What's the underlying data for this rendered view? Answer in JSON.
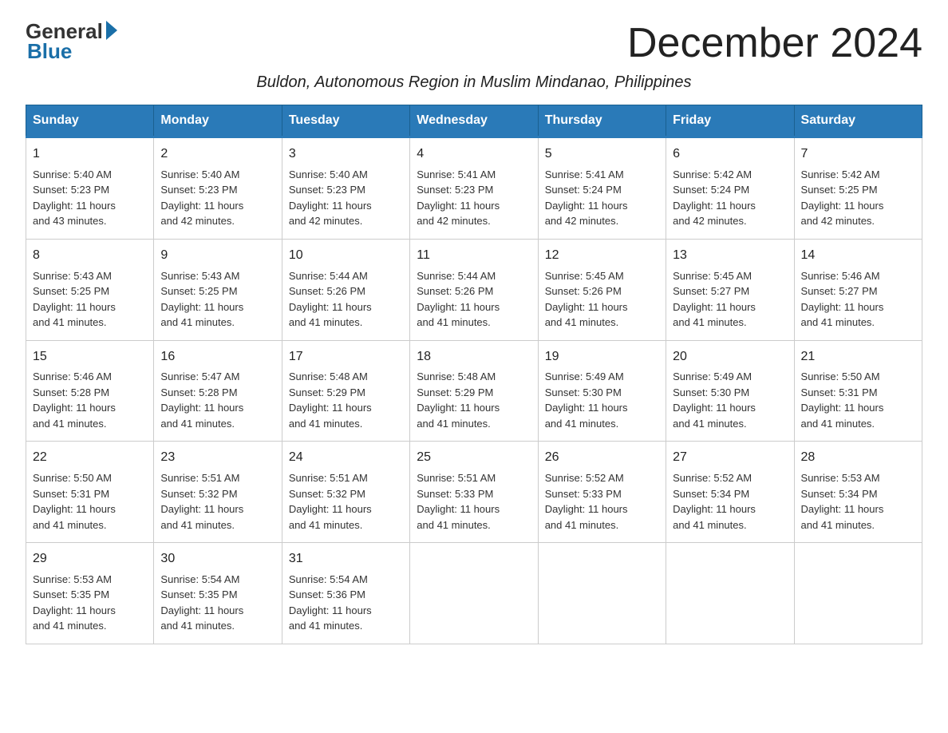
{
  "logo": {
    "general": "General",
    "blue": "Blue"
  },
  "title": "December 2024",
  "subtitle": "Buldon, Autonomous Region in Muslim Mindanao, Philippines",
  "days_header": [
    "Sunday",
    "Monday",
    "Tuesday",
    "Wednesday",
    "Thursday",
    "Friday",
    "Saturday"
  ],
  "weeks": [
    [
      {
        "num": "1",
        "sunrise": "5:40 AM",
        "sunset": "5:23 PM",
        "daylight": "11 hours and 43 minutes."
      },
      {
        "num": "2",
        "sunrise": "5:40 AM",
        "sunset": "5:23 PM",
        "daylight": "11 hours and 42 minutes."
      },
      {
        "num": "3",
        "sunrise": "5:40 AM",
        "sunset": "5:23 PM",
        "daylight": "11 hours and 42 minutes."
      },
      {
        "num": "4",
        "sunrise": "5:41 AM",
        "sunset": "5:23 PM",
        "daylight": "11 hours and 42 minutes."
      },
      {
        "num": "5",
        "sunrise": "5:41 AM",
        "sunset": "5:24 PM",
        "daylight": "11 hours and 42 minutes."
      },
      {
        "num": "6",
        "sunrise": "5:42 AM",
        "sunset": "5:24 PM",
        "daylight": "11 hours and 42 minutes."
      },
      {
        "num": "7",
        "sunrise": "5:42 AM",
        "sunset": "5:25 PM",
        "daylight": "11 hours and 42 minutes."
      }
    ],
    [
      {
        "num": "8",
        "sunrise": "5:43 AM",
        "sunset": "5:25 PM",
        "daylight": "11 hours and 41 minutes."
      },
      {
        "num": "9",
        "sunrise": "5:43 AM",
        "sunset": "5:25 PM",
        "daylight": "11 hours and 41 minutes."
      },
      {
        "num": "10",
        "sunrise": "5:44 AM",
        "sunset": "5:26 PM",
        "daylight": "11 hours and 41 minutes."
      },
      {
        "num": "11",
        "sunrise": "5:44 AM",
        "sunset": "5:26 PM",
        "daylight": "11 hours and 41 minutes."
      },
      {
        "num": "12",
        "sunrise": "5:45 AM",
        "sunset": "5:26 PM",
        "daylight": "11 hours and 41 minutes."
      },
      {
        "num": "13",
        "sunrise": "5:45 AM",
        "sunset": "5:27 PM",
        "daylight": "11 hours and 41 minutes."
      },
      {
        "num": "14",
        "sunrise": "5:46 AM",
        "sunset": "5:27 PM",
        "daylight": "11 hours and 41 minutes."
      }
    ],
    [
      {
        "num": "15",
        "sunrise": "5:46 AM",
        "sunset": "5:28 PM",
        "daylight": "11 hours and 41 minutes."
      },
      {
        "num": "16",
        "sunrise": "5:47 AM",
        "sunset": "5:28 PM",
        "daylight": "11 hours and 41 minutes."
      },
      {
        "num": "17",
        "sunrise": "5:48 AM",
        "sunset": "5:29 PM",
        "daylight": "11 hours and 41 minutes."
      },
      {
        "num": "18",
        "sunrise": "5:48 AM",
        "sunset": "5:29 PM",
        "daylight": "11 hours and 41 minutes."
      },
      {
        "num": "19",
        "sunrise": "5:49 AM",
        "sunset": "5:30 PM",
        "daylight": "11 hours and 41 minutes."
      },
      {
        "num": "20",
        "sunrise": "5:49 AM",
        "sunset": "5:30 PM",
        "daylight": "11 hours and 41 minutes."
      },
      {
        "num": "21",
        "sunrise": "5:50 AM",
        "sunset": "5:31 PM",
        "daylight": "11 hours and 41 minutes."
      }
    ],
    [
      {
        "num": "22",
        "sunrise": "5:50 AM",
        "sunset": "5:31 PM",
        "daylight": "11 hours and 41 minutes."
      },
      {
        "num": "23",
        "sunrise": "5:51 AM",
        "sunset": "5:32 PM",
        "daylight": "11 hours and 41 minutes."
      },
      {
        "num": "24",
        "sunrise": "5:51 AM",
        "sunset": "5:32 PM",
        "daylight": "11 hours and 41 minutes."
      },
      {
        "num": "25",
        "sunrise": "5:51 AM",
        "sunset": "5:33 PM",
        "daylight": "11 hours and 41 minutes."
      },
      {
        "num": "26",
        "sunrise": "5:52 AM",
        "sunset": "5:33 PM",
        "daylight": "11 hours and 41 minutes."
      },
      {
        "num": "27",
        "sunrise": "5:52 AM",
        "sunset": "5:34 PM",
        "daylight": "11 hours and 41 minutes."
      },
      {
        "num": "28",
        "sunrise": "5:53 AM",
        "sunset": "5:34 PM",
        "daylight": "11 hours and 41 minutes."
      }
    ],
    [
      {
        "num": "29",
        "sunrise": "5:53 AM",
        "sunset": "5:35 PM",
        "daylight": "11 hours and 41 minutes."
      },
      {
        "num": "30",
        "sunrise": "5:54 AM",
        "sunset": "5:35 PM",
        "daylight": "11 hours and 41 minutes."
      },
      {
        "num": "31",
        "sunrise": "5:54 AM",
        "sunset": "5:36 PM",
        "daylight": "11 hours and 41 minutes."
      },
      null,
      null,
      null,
      null
    ]
  ],
  "sunrise_label": "Sunrise:",
  "sunset_label": "Sunset:",
  "daylight_label": "Daylight:"
}
